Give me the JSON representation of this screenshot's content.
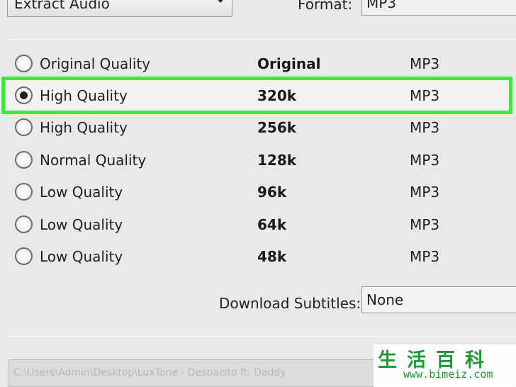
{
  "header": {
    "mode_dropdown_value": "Extract Audio",
    "format_label": "Format:",
    "format_value": "MP3"
  },
  "quality_options": [
    {
      "label": "Original Quality",
      "bitrate": "Original",
      "format": "MP3",
      "selected": false
    },
    {
      "label": "High Quality",
      "bitrate": "320k",
      "format": "MP3",
      "selected": true
    },
    {
      "label": "High Quality",
      "bitrate": "256k",
      "format": "MP3",
      "selected": false
    },
    {
      "label": "Normal Quality",
      "bitrate": "128k",
      "format": "MP3",
      "selected": false
    },
    {
      "label": "Low Quality",
      "bitrate": "96k",
      "format": "MP3",
      "selected": false
    },
    {
      "label": "Low Quality",
      "bitrate": "64k",
      "format": "MP3",
      "selected": false
    },
    {
      "label": "Low Quality",
      "bitrate": "48k",
      "format": "MP3",
      "selected": false
    }
  ],
  "subtitles": {
    "label": "Download Subtitles:",
    "value": "None"
  },
  "output_path": "C:\\Users\\Admin\\Desktop\\LuxTone - Despacito ft. Daddy",
  "watermark": {
    "chinese": "生活百科",
    "url": "www.bimeiz.com"
  },
  "colors": {
    "highlight": "#3ee83e",
    "background": "#e9e9e9",
    "watermark": "#1f9a36"
  }
}
